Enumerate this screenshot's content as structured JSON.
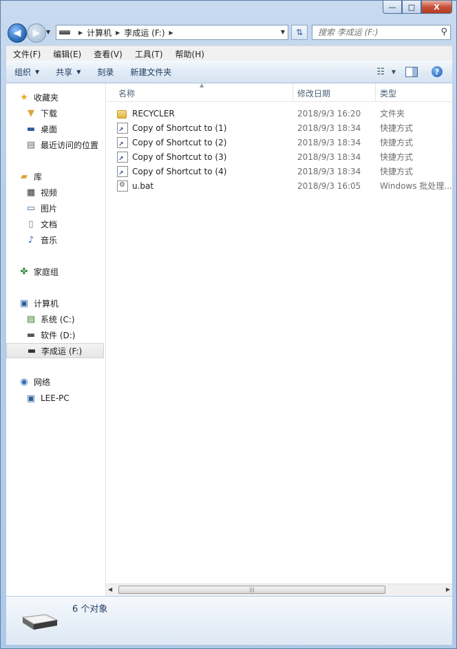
{
  "window": {
    "title": "李成运 (F:)"
  },
  "caption": {
    "minimize": "—",
    "maximize": "□",
    "close": "X"
  },
  "address": {
    "crumbs": [
      "计算机",
      "李成运 (F:)"
    ]
  },
  "search": {
    "placeholder": "搜索 李成运 (F:)"
  },
  "menu": [
    "文件(F)",
    "编辑(E)",
    "查看(V)",
    "工具(T)",
    "帮助(H)"
  ],
  "toolbar": {
    "organize": "组织",
    "share": "共享",
    "burn": "刻录",
    "new_folder": "新建文件夹",
    "help": "?"
  },
  "nav": {
    "favorites": "收藏夹",
    "downloads": "下载",
    "desktop": "桌面",
    "recent": "最近访问的位置",
    "libraries": "库",
    "videos": "视频",
    "pictures": "图片",
    "documents": "文档",
    "music": "音乐",
    "homegroup": "家庭组",
    "computer": "计算机",
    "drive_c": "系统 (C:)",
    "drive_d": "软件 (D:)",
    "drive_f": "李成运 (F:)",
    "network": "网络",
    "lee_pc": "LEE-PC"
  },
  "columns": {
    "name": "名称",
    "date": "修改日期",
    "type": "类型"
  },
  "files": [
    {
      "name": "RECYCLER",
      "date": "2018/9/3 16:20",
      "type": "文件夹",
      "icon": "folder-icon"
    },
    {
      "name": "Copy of Shortcut to (1)",
      "date": "2018/9/3 18:34",
      "type": "快捷方式",
      "icon": "shortcut-icon"
    },
    {
      "name": "Copy of Shortcut to (2)",
      "date": "2018/9/3 18:34",
      "type": "快捷方式",
      "icon": "shortcut-icon"
    },
    {
      "name": "Copy of Shortcut to (3)",
      "date": "2018/9/3 18:34",
      "type": "快捷方式",
      "icon": "shortcut-icon"
    },
    {
      "name": "Copy of Shortcut to (4)",
      "date": "2018/9/3 18:34",
      "type": "快捷方式",
      "icon": "shortcut-icon"
    },
    {
      "name": "u.bat",
      "date": "2018/9/3 16:05",
      "type": "Windows 批处理...",
      "icon": "batch-file-icon"
    }
  ],
  "status": {
    "count": "6 个对象"
  }
}
